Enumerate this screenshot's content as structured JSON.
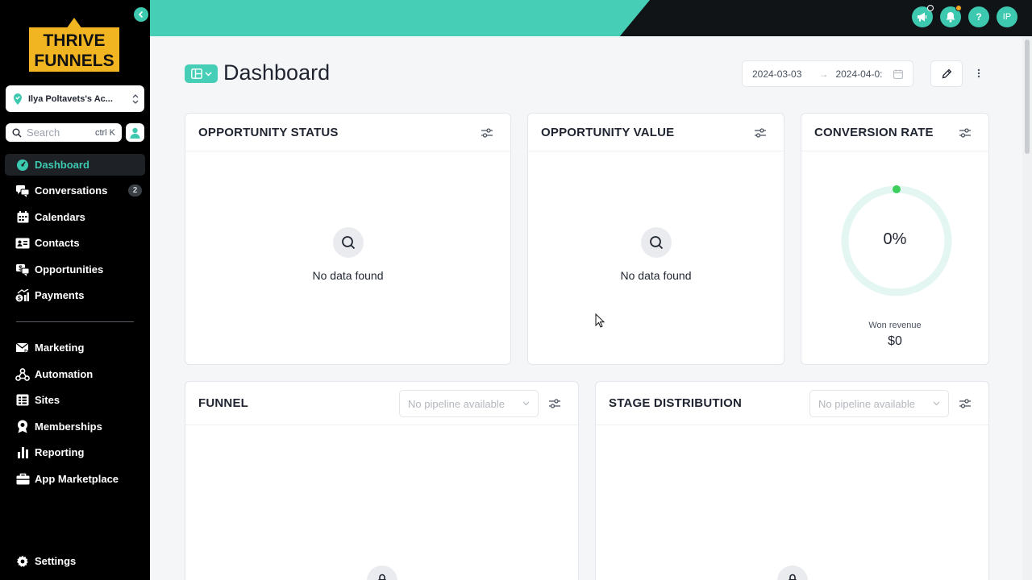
{
  "sidebar": {
    "logo_line1": "THRIVE",
    "logo_line2": "FUNNELS",
    "account_name": "Ilya Poltavets's Ac...",
    "search_placeholder": "Search",
    "search_shortcut": "ctrl K",
    "nav_items": [
      {
        "label": "Dashboard",
        "icon": "dashboard-icon",
        "active": true
      },
      {
        "label": "Conversations",
        "icon": "chat-icon",
        "badge": "2"
      },
      {
        "label": "Calendars",
        "icon": "calendar-icon"
      },
      {
        "label": "Contacts",
        "icon": "contact-card-icon"
      },
      {
        "label": "Opportunities",
        "icon": "dollar-chat-icon"
      },
      {
        "label": "Payments",
        "icon": "payments-chart-icon"
      }
    ],
    "nav_items_2": [
      {
        "label": "Marketing",
        "icon": "mail-send-icon"
      },
      {
        "label": "Automation",
        "icon": "workflow-icon"
      },
      {
        "label": "Sites",
        "icon": "sites-icon"
      },
      {
        "label": "Memberships",
        "icon": "membership-badge-icon"
      },
      {
        "label": "Reporting",
        "icon": "bar-chart-icon"
      },
      {
        "label": "App Marketplace",
        "icon": "briefcase-icon"
      }
    ],
    "settings_label": "Settings"
  },
  "topbar": {
    "avatar_initials": "IP",
    "help": "?"
  },
  "header": {
    "title": "Dashboard",
    "date_start": "2024-03-03",
    "date_end": "2024-04-0:",
    "arrow": "→"
  },
  "cards": {
    "opportunity_status": {
      "title": "OPPORTUNITY STATUS",
      "empty_text": "No data found"
    },
    "opportunity_value": {
      "title": "OPPORTUNITY VALUE",
      "empty_text": "No data found"
    },
    "conversion_rate": {
      "title": "CONVERSION RATE",
      "value": "0%",
      "won_label": "Won revenue",
      "won_value": "$0",
      "rate_fraction": 0
    },
    "funnel": {
      "title": "FUNNEL",
      "select_placeholder": "No pipeline available"
    },
    "stage_distribution": {
      "title": "STAGE DISTRIBUTION",
      "select_placeholder": "No pipeline available"
    }
  },
  "colors": {
    "accent": "#46cfb6",
    "sidebar_bg": "#000000",
    "gauge_track": "#e3f6f2",
    "gauge_dot": "#3ccf5c"
  }
}
